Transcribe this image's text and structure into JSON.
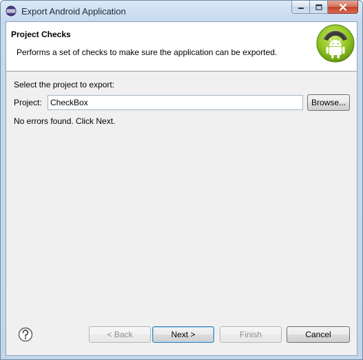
{
  "window": {
    "title": "Export Android Application"
  },
  "header": {
    "title": "Project Checks",
    "description": "Performs a set of checks to make sure the application can be exported."
  },
  "form": {
    "select_label": "Select the project to export:",
    "project_label": "Project:",
    "project_value": "CheckBox",
    "browse_label": "Browse...",
    "status_text": "No errors found. Click Next."
  },
  "footer": {
    "back_label": "< Back",
    "next_label": "Next >",
    "finish_label": "Finish",
    "cancel_label": "Cancel"
  },
  "icons": {
    "app": "eclipse-icon",
    "wizard": "android-logo",
    "help": "help-icon"
  },
  "colors": {
    "titlebar": "#c7d9ee",
    "close_button": "#c0412a",
    "android_green": "#8fc31f",
    "default_button_border": "#3c7fb1"
  }
}
